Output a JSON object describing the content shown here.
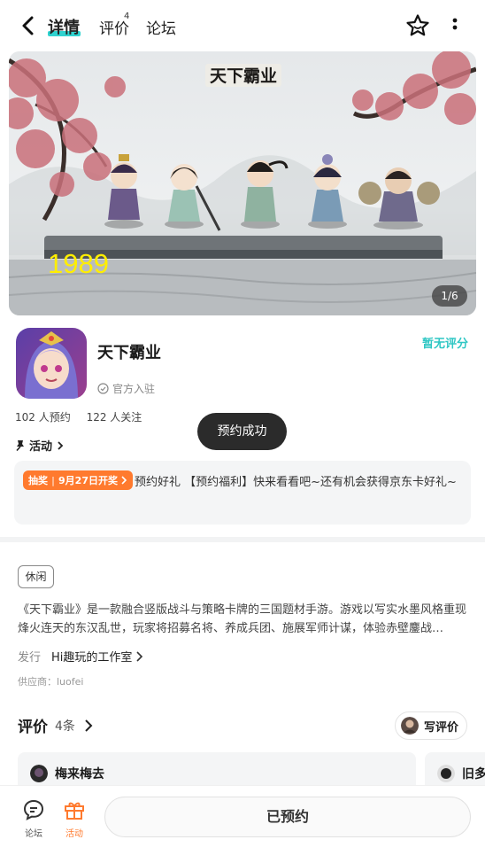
{
  "header": {
    "tabs": [
      {
        "label": "详情",
        "active": true
      },
      {
        "label": "评价",
        "badge": "4"
      },
      {
        "label": "论坛"
      }
    ]
  },
  "banner": {
    "logo_text": "天下霸业",
    "overlay_number": "1989",
    "pager": "1/6"
  },
  "game": {
    "title": "天下霸业",
    "verified_label": "官方入驻",
    "score_label": "暂无评分",
    "reservations": "102 人预约",
    "followers": "122 人关注",
    "activity_label": "活动"
  },
  "toast": "预约成功",
  "event": {
    "badge_left": "抽奖",
    "badge_right": "9月27日开奖",
    "text": "预约好礼 【预约福利】快来看看吧~还有机会获得京东卡好礼~"
  },
  "description": {
    "tag": "休闲",
    "text": "《天下霸业》是一款融合竖版战斗与策略卡牌的三国题材手游。游戏以写实水墨风格重现烽火连天的东汉乱世，玩家将招募名将、养成兵团、施展军师计谋，体验赤壁鏖战…",
    "publisher_label": "发行",
    "publisher": "Hi趣玩的工作室",
    "supplier": "供应商：luofei"
  },
  "reviews": {
    "title": "评价",
    "count": "4条",
    "write_label": "写评价",
    "cards": [
      {
        "user": "梅来梅去"
      },
      {
        "user": "旧多"
      }
    ]
  },
  "bottom": {
    "forum_label": "论坛",
    "activity_label": "活动",
    "main_button": "已预约"
  },
  "colors": {
    "accent": "#2fd2cf",
    "orange": "#ff7a2e"
  }
}
